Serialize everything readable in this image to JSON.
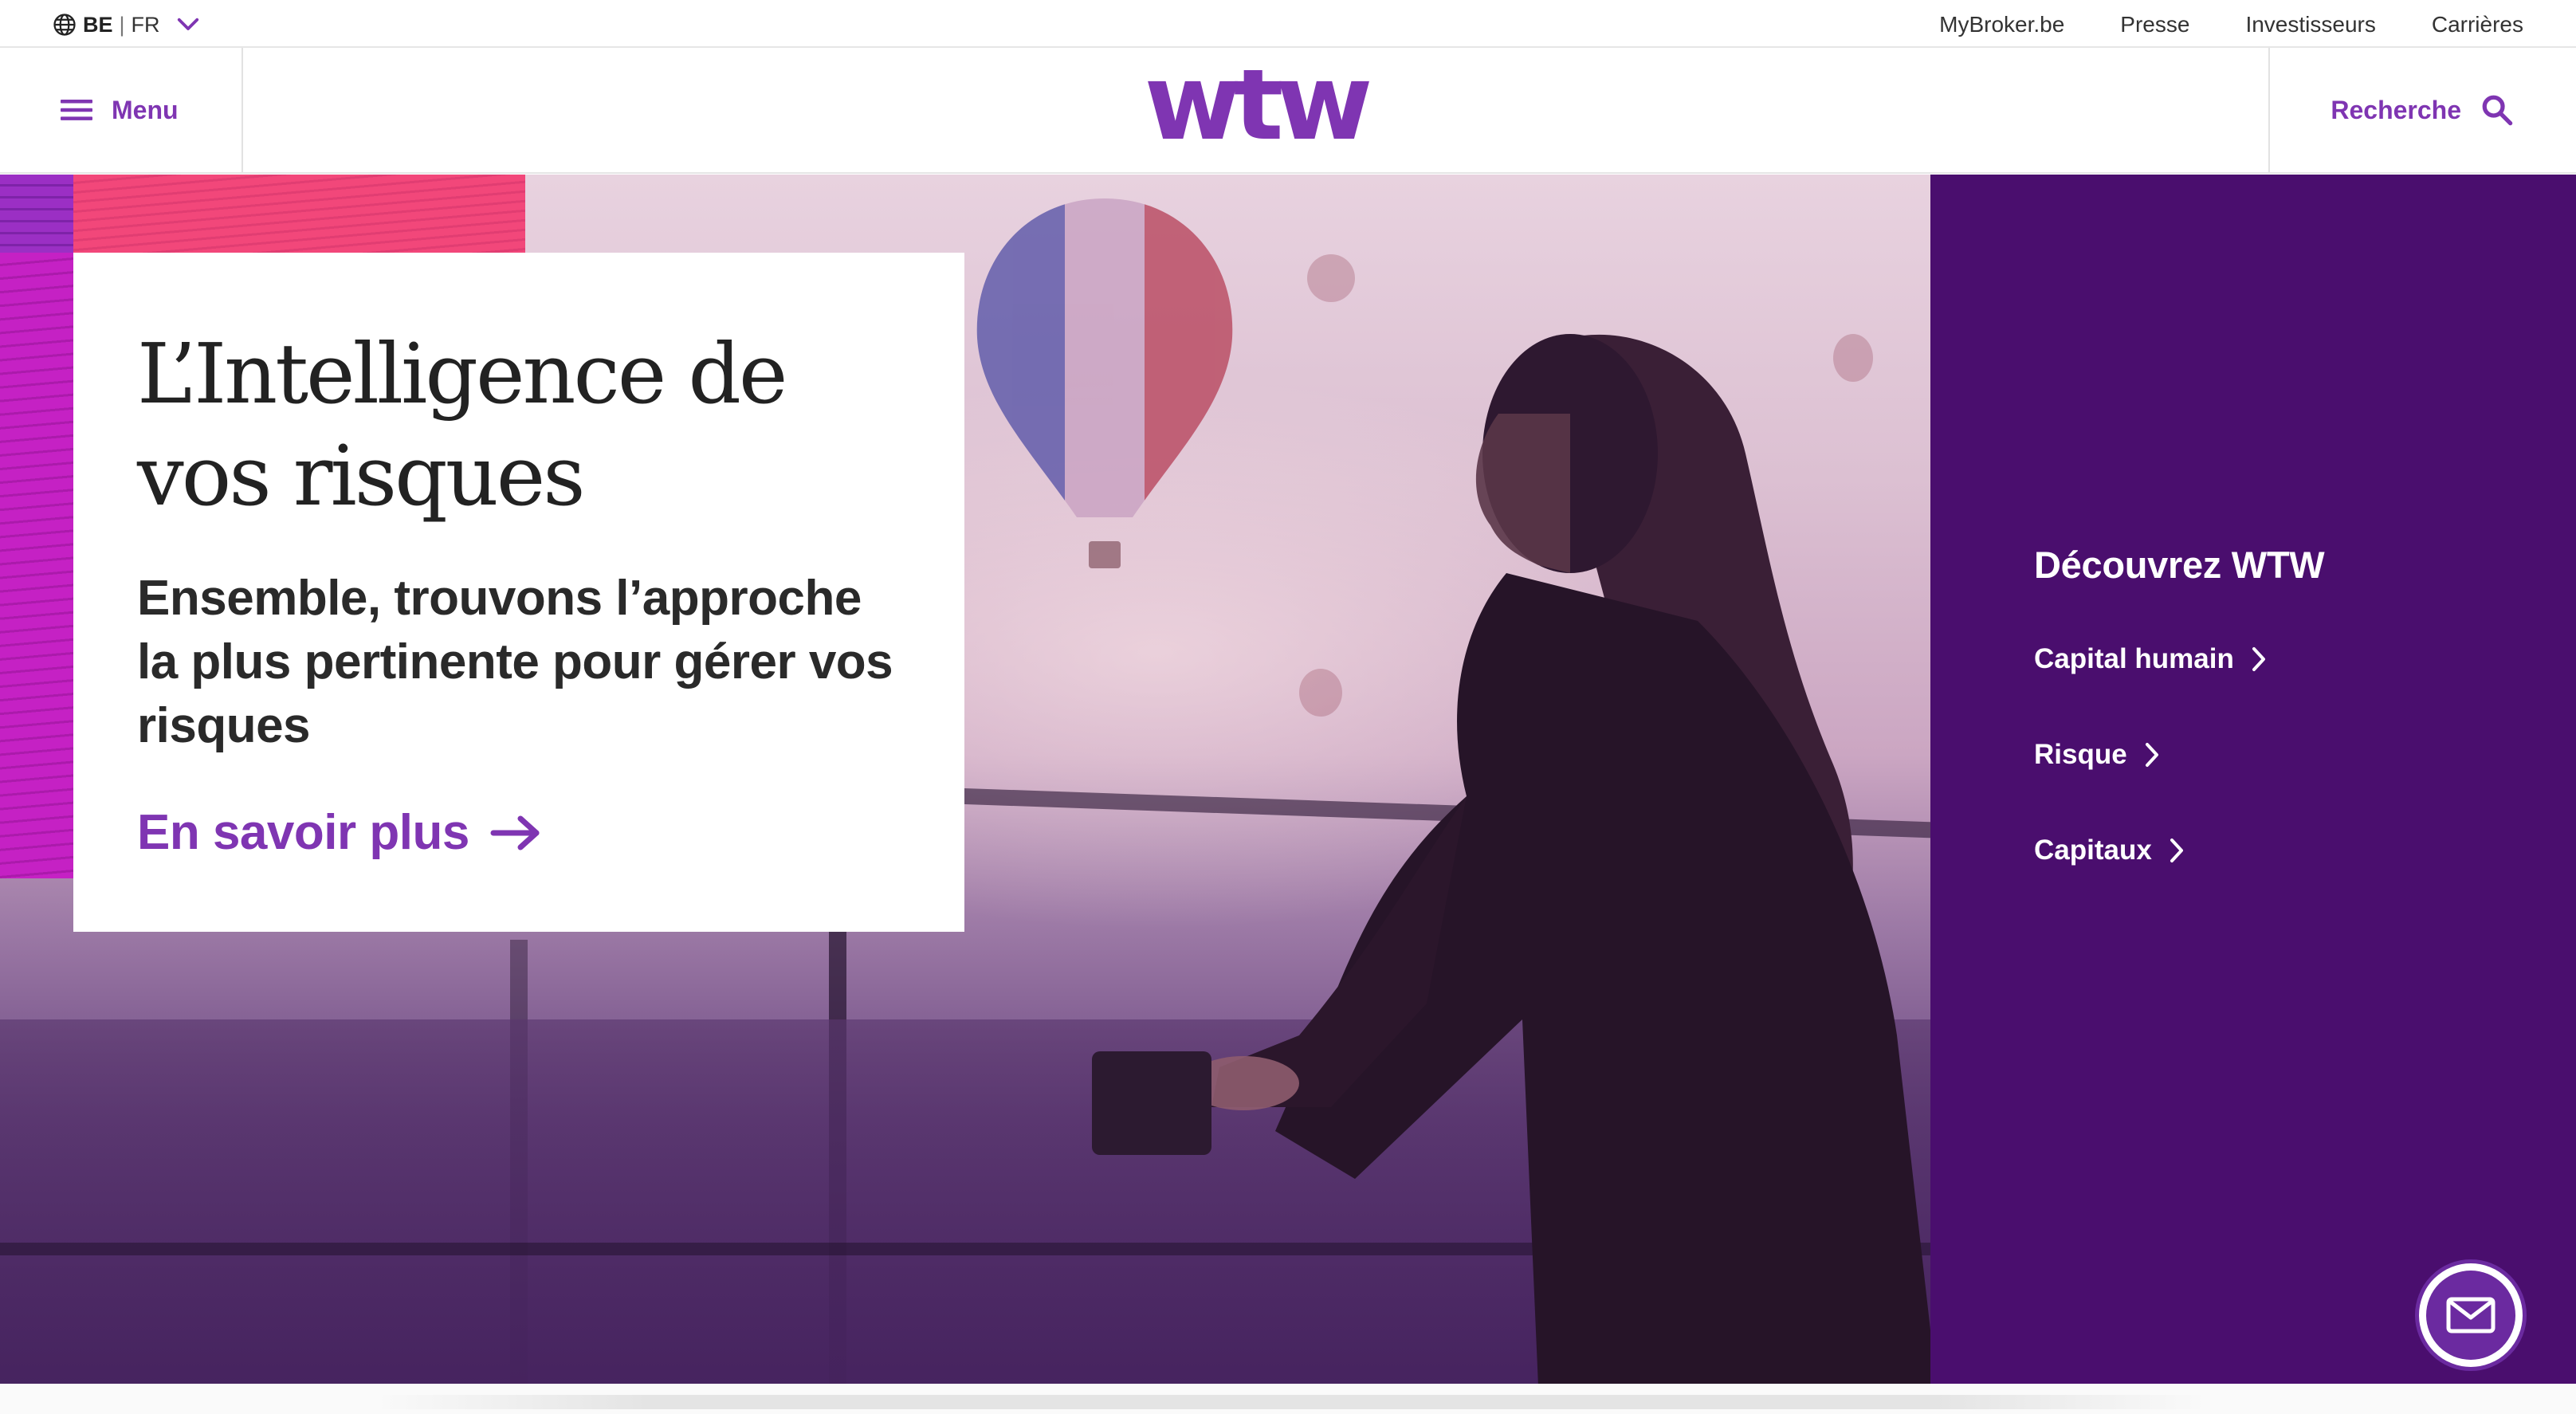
{
  "utility": {
    "country": "BE",
    "separator": "|",
    "language": "FR",
    "links": [
      "MyBroker.be",
      "Presse",
      "Investisseurs",
      "Carrières"
    ]
  },
  "header": {
    "menu_label": "Menu",
    "search_label": "Recherche",
    "logo_text": "wtw"
  },
  "hero": {
    "title": "L’Intelligence de vos risques",
    "lead": "Ensemble, trouvons l’approche la plus pertinente pour gérer vos risques",
    "cta": "En savoir plus"
  },
  "discover": {
    "heading": "Découvrez WTW",
    "links": [
      "Capital humain",
      "Risque",
      "Capitaux"
    ]
  },
  "colors": {
    "brand_purple": "#7f35b2",
    "panel_purple": "#4a0e6e",
    "accent_pink": "#f2477a",
    "accent_magenta": "#c521c4"
  },
  "icons": {
    "locale": "globe-icon",
    "locale_toggle": "chevron-down-icon",
    "menu": "hamburger-icon",
    "search": "search-icon",
    "cta": "arrow-right-icon",
    "discover_links": "chevron-right-icon",
    "contact": "mail-icon"
  }
}
